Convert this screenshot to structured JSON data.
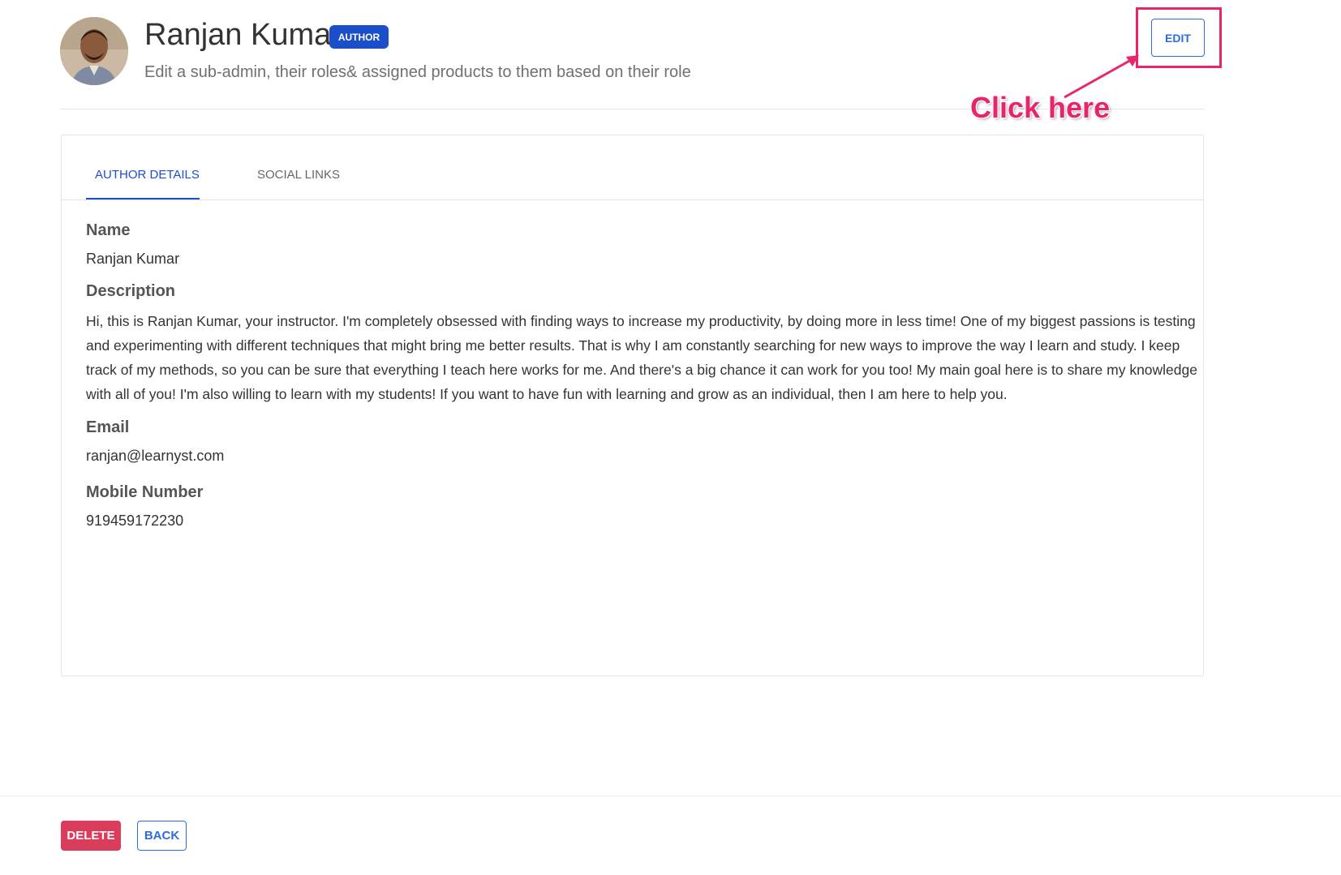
{
  "header": {
    "name": "Ranjan Kumar",
    "badge": "AUTHOR",
    "subtitle": "Edit a sub-admin, their roles& assigned products to them based on their role",
    "edit_label": "EDIT"
  },
  "annotation": {
    "callout": "Click here",
    "color": "#e8246b"
  },
  "tabs": [
    {
      "label": "AUTHOR DETAILS",
      "active": true
    },
    {
      "label": "SOCIAL LINKS",
      "active": false
    }
  ],
  "details": {
    "name_label": "Name",
    "name_value": "Ranjan Kumar",
    "description_label": "Description",
    "description_value": "Hi, this is Ranjan Kumar, your instructor.  I'm completely obsessed with finding ways to increase my productivity, by doing more in less time! One of my biggest passions is testing and experimenting with different techniques that might bring me better results. That is why I am constantly searching for new ways to improve the way I learn and study. I keep track of my methods, so you can be sure that everything I teach here works for me. And there's a big chance it can work for you too! My main goal here is to share my knowledge with all of you! I'm also willing to learn with my students! If you want to have fun with learning and grow as an individual, then I am here to help you.",
    "email_label": "Email",
    "email_value": "ranjan@learnyst.com",
    "mobile_label": "Mobile Number",
    "mobile_value": "919459172230"
  },
  "footer": {
    "delete_label": "DELETE",
    "back_label": "BACK"
  },
  "colors": {
    "primary": "#1a4fc9",
    "button_outline": "#2d6cdf",
    "danger": "#dc3c5c",
    "highlight": "#e8246b"
  },
  "icons": {
    "avatar": "user-photo"
  }
}
